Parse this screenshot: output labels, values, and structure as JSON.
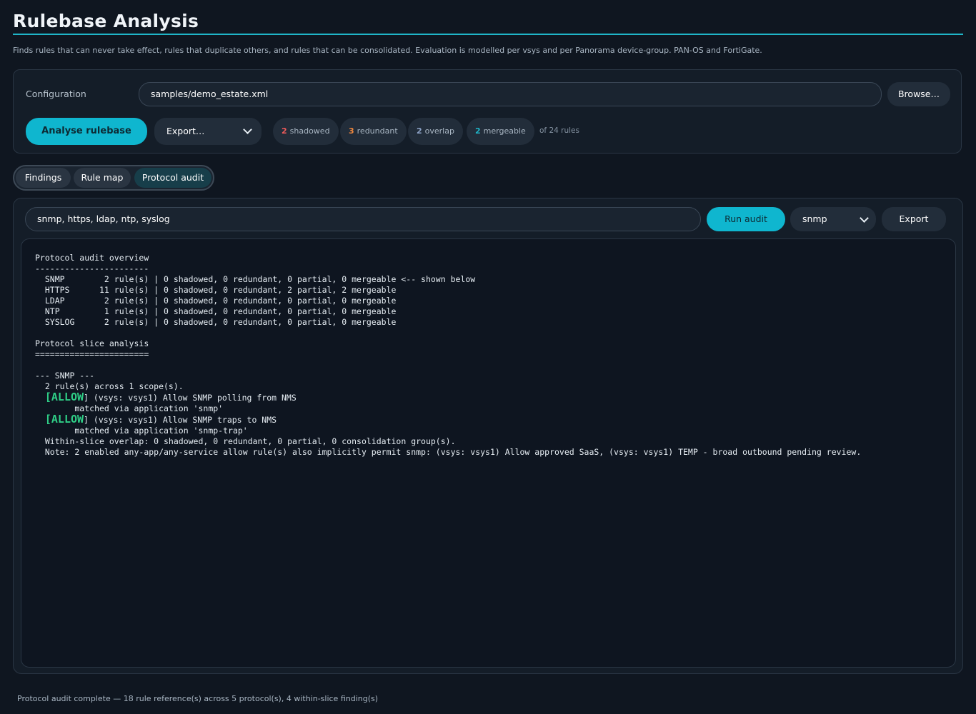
{
  "page": {
    "title": "Rulebase Analysis",
    "subtitle": "Finds rules that can never take effect, rules that duplicate others, and rules that can be consolidated. Evaluation is modelled per vsys and per Panorama device-group. PAN-OS and FortiGate."
  },
  "config": {
    "label": "Configuration",
    "path": "samples/demo_estate.xml",
    "browse_label": "Browse…",
    "analyse_label": "Analyse rulebase",
    "export_select": "Export…"
  },
  "summary": {
    "shadowed": {
      "count": "2",
      "label": "shadowed"
    },
    "redundant": {
      "count": "3",
      "label": "redundant"
    },
    "overlap": {
      "count": "2",
      "label": "overlap"
    },
    "mergeable": {
      "count": "2",
      "label": "mergeable"
    },
    "of_rules": "of 24 rules"
  },
  "tabs": [
    {
      "label": "Findings"
    },
    {
      "label": "Rule map"
    },
    {
      "label": "Protocol audit"
    }
  ],
  "audit": {
    "protocols_value": "snmp, https, ldap, ntp, syslog",
    "run_label": "Run audit",
    "protocol_select": "snmp",
    "export_label": "Export"
  },
  "output": {
    "overview_header": "Protocol audit overview",
    "overview_rule": "-----------------------",
    "overview_rows": [
      "  SNMP        2 rule(s) | 0 shadowed, 0 redundant, 0 partial, 0 mergeable <-- shown below",
      "  HTTPS      11 rule(s) | 0 shadowed, 0 redundant, 2 partial, 2 mergeable",
      "  LDAP        2 rule(s) | 0 shadowed, 0 redundant, 0 partial, 0 mergeable",
      "  NTP         1 rule(s) | 0 shadowed, 0 redundant, 0 partial, 0 mergeable",
      "  SYSLOG      2 rule(s) | 0 shadowed, 0 redundant, 0 partial, 0 mergeable"
    ],
    "slice_header": "Protocol slice analysis",
    "slice_rule": "=======================",
    "snmp_header": "--- SNMP ---",
    "snmp_scope": "  2 rule(s) across 1 scope(s).",
    "entries": [
      {
        "tag": "[ALLOW",
        "rest": "] (vsys: vsys1) Allow SNMP polling from NMS",
        "match": "        matched via application 'snmp'"
      },
      {
        "tag": "[ALLOW",
        "rest": "] (vsys: vsys1) Allow SNMP traps to NMS",
        "match": "        matched via application 'snmp-trap'"
      }
    ],
    "overlap_line": "  Within-slice overlap: 0 shadowed, 0 redundant, 0 partial, 0 consolidation group(s).",
    "note_line": "  Note: 2 enabled any-app/any-service allow rule(s) also implicitly permit snmp: (vsys: vsys1) Allow approved SaaS, (vsys: vsys1) TEMP - broad outbound pending review."
  },
  "status": "Protocol audit complete — 18 rule reference(s) across 5 protocol(s), 4 within-slice finding(s)",
  "colors": {
    "accent": "#0fb6cf",
    "shadowed": "#f05a5a",
    "redundant": "#f0883e",
    "overlap": "#8ea4c8",
    "mergeable": "#1fb5c8",
    "allow": "#2fcf87"
  }
}
